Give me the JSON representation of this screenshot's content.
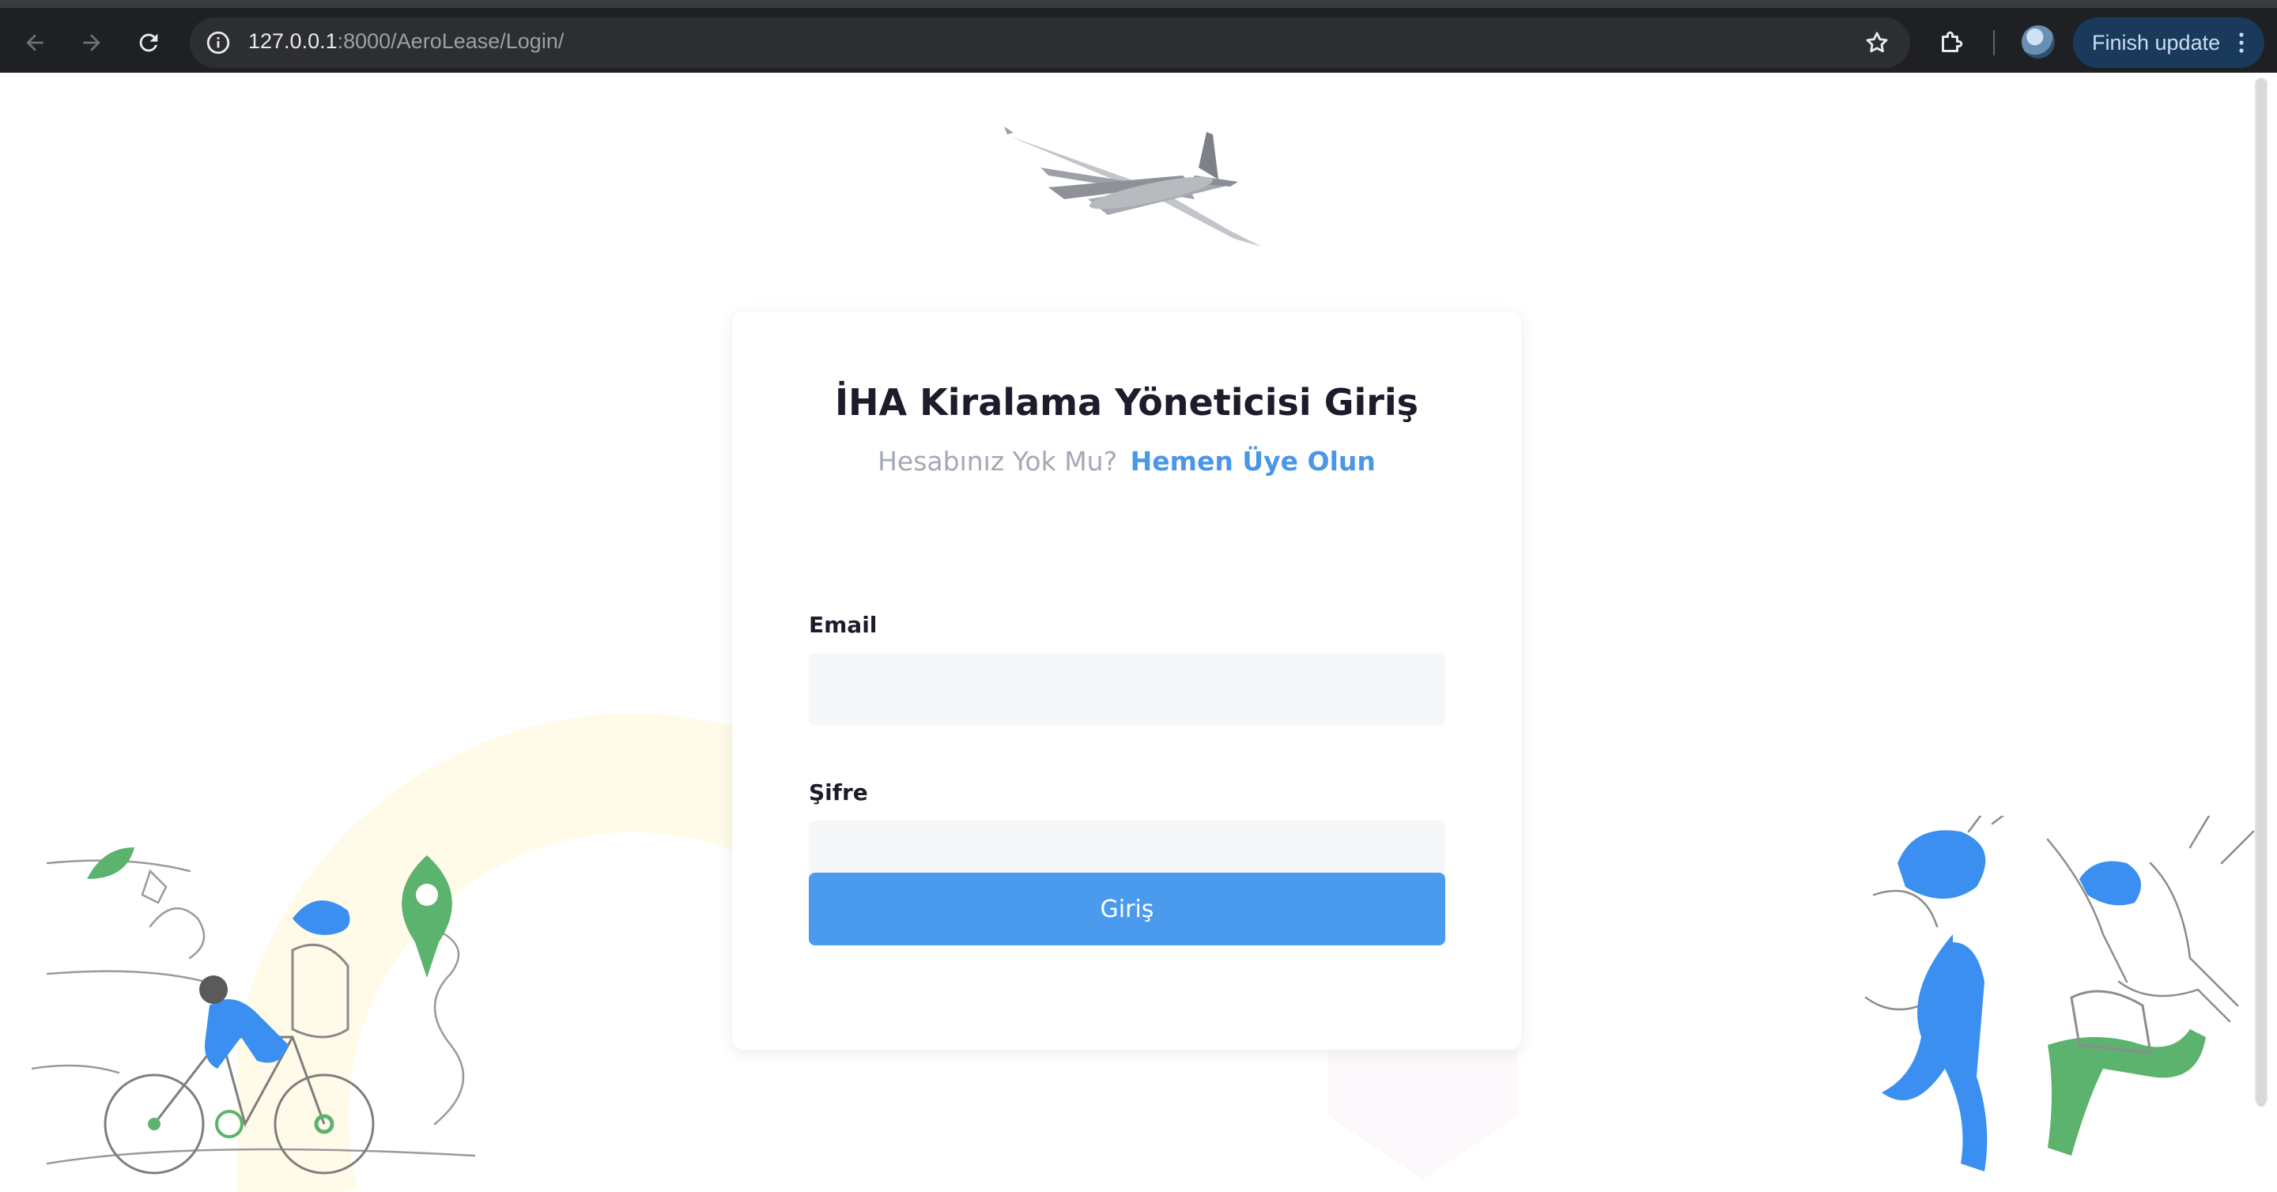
{
  "browser": {
    "url_host": "127.0.0.1",
    "url_rest": ":8000/AeroLease/Login/",
    "update_button_label": "Finish update",
    "icons": [
      "back-arrow-icon",
      "forward-arrow-icon",
      "reload-icon",
      "site-info-icon",
      "bookmark-star-icon",
      "extensions-icon",
      "profile-avatar",
      "more-vert-icon"
    ]
  },
  "login": {
    "title": "İHA Kiralama Yöneticisi Giriş",
    "subtitle_prefix": "Hesabınız Yok Mu?",
    "signup_link": "Hemen Üye Olun",
    "email_label": "Email",
    "email_value": "",
    "password_label": "Şifre",
    "password_value": "",
    "submit_label": "Giriş"
  },
  "colors": {
    "accent": "#4a9bee",
    "link": "#4a97e8",
    "chrome_bg": "#1f2023",
    "field_bg": "#f6f7f9"
  }
}
